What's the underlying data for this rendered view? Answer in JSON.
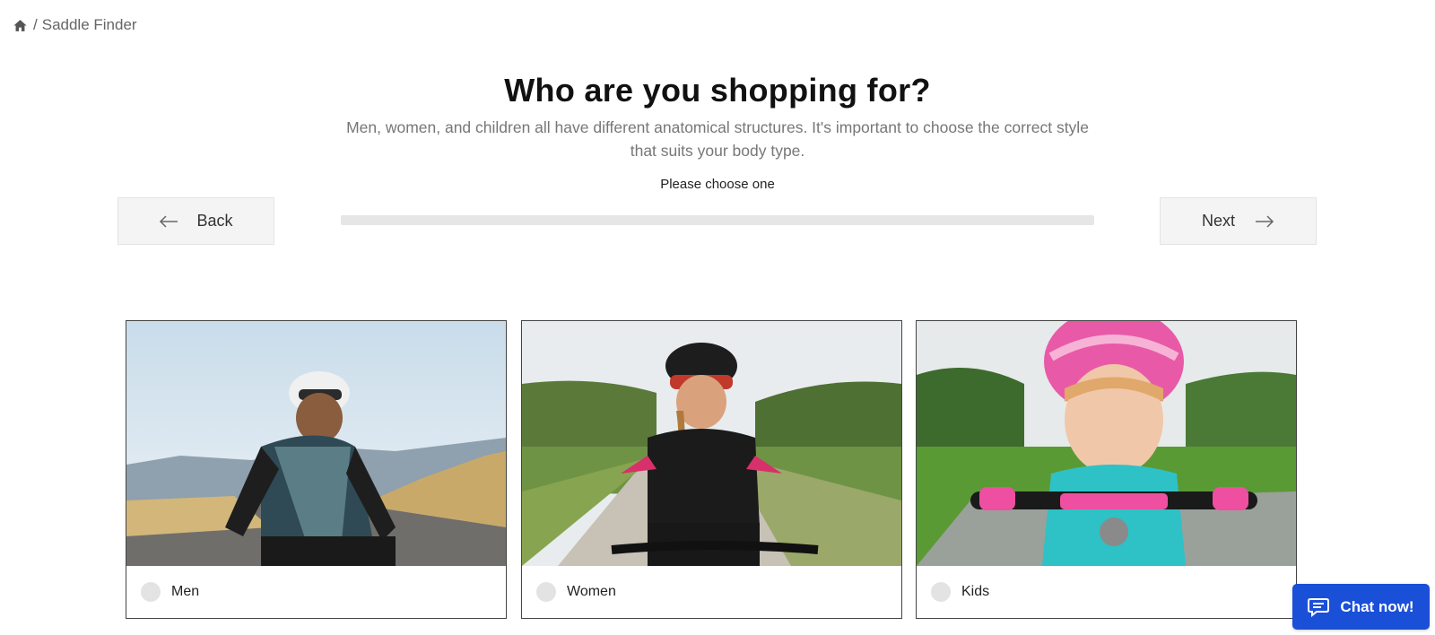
{
  "breadcrumb": {
    "separator": "/",
    "current": "Saddle Finder",
    "home_icon": "home-icon"
  },
  "header": {
    "title": "Who are you shopping for?",
    "subtitle": "Men, women, and children all have different anatomical structures. It's important to choose the correct style that suits your body type.",
    "instruction": "Please choose one"
  },
  "nav": {
    "back_label": "Back",
    "next_label": "Next",
    "back_icon": "arrow-left-icon",
    "next_icon": "arrow-right-icon"
  },
  "progress": {
    "value": 0
  },
  "options": [
    {
      "label": "Men",
      "selected": false,
      "image": "cyclist-man-photo"
    },
    {
      "label": "Women",
      "selected": false,
      "image": "cyclist-woman-photo"
    },
    {
      "label": "Kids",
      "selected": false,
      "image": "child-on-bike-photo"
    }
  ],
  "chat": {
    "label": "Chat now!",
    "icon": "chat-bubble-icon",
    "color": "#1a4fd8"
  }
}
